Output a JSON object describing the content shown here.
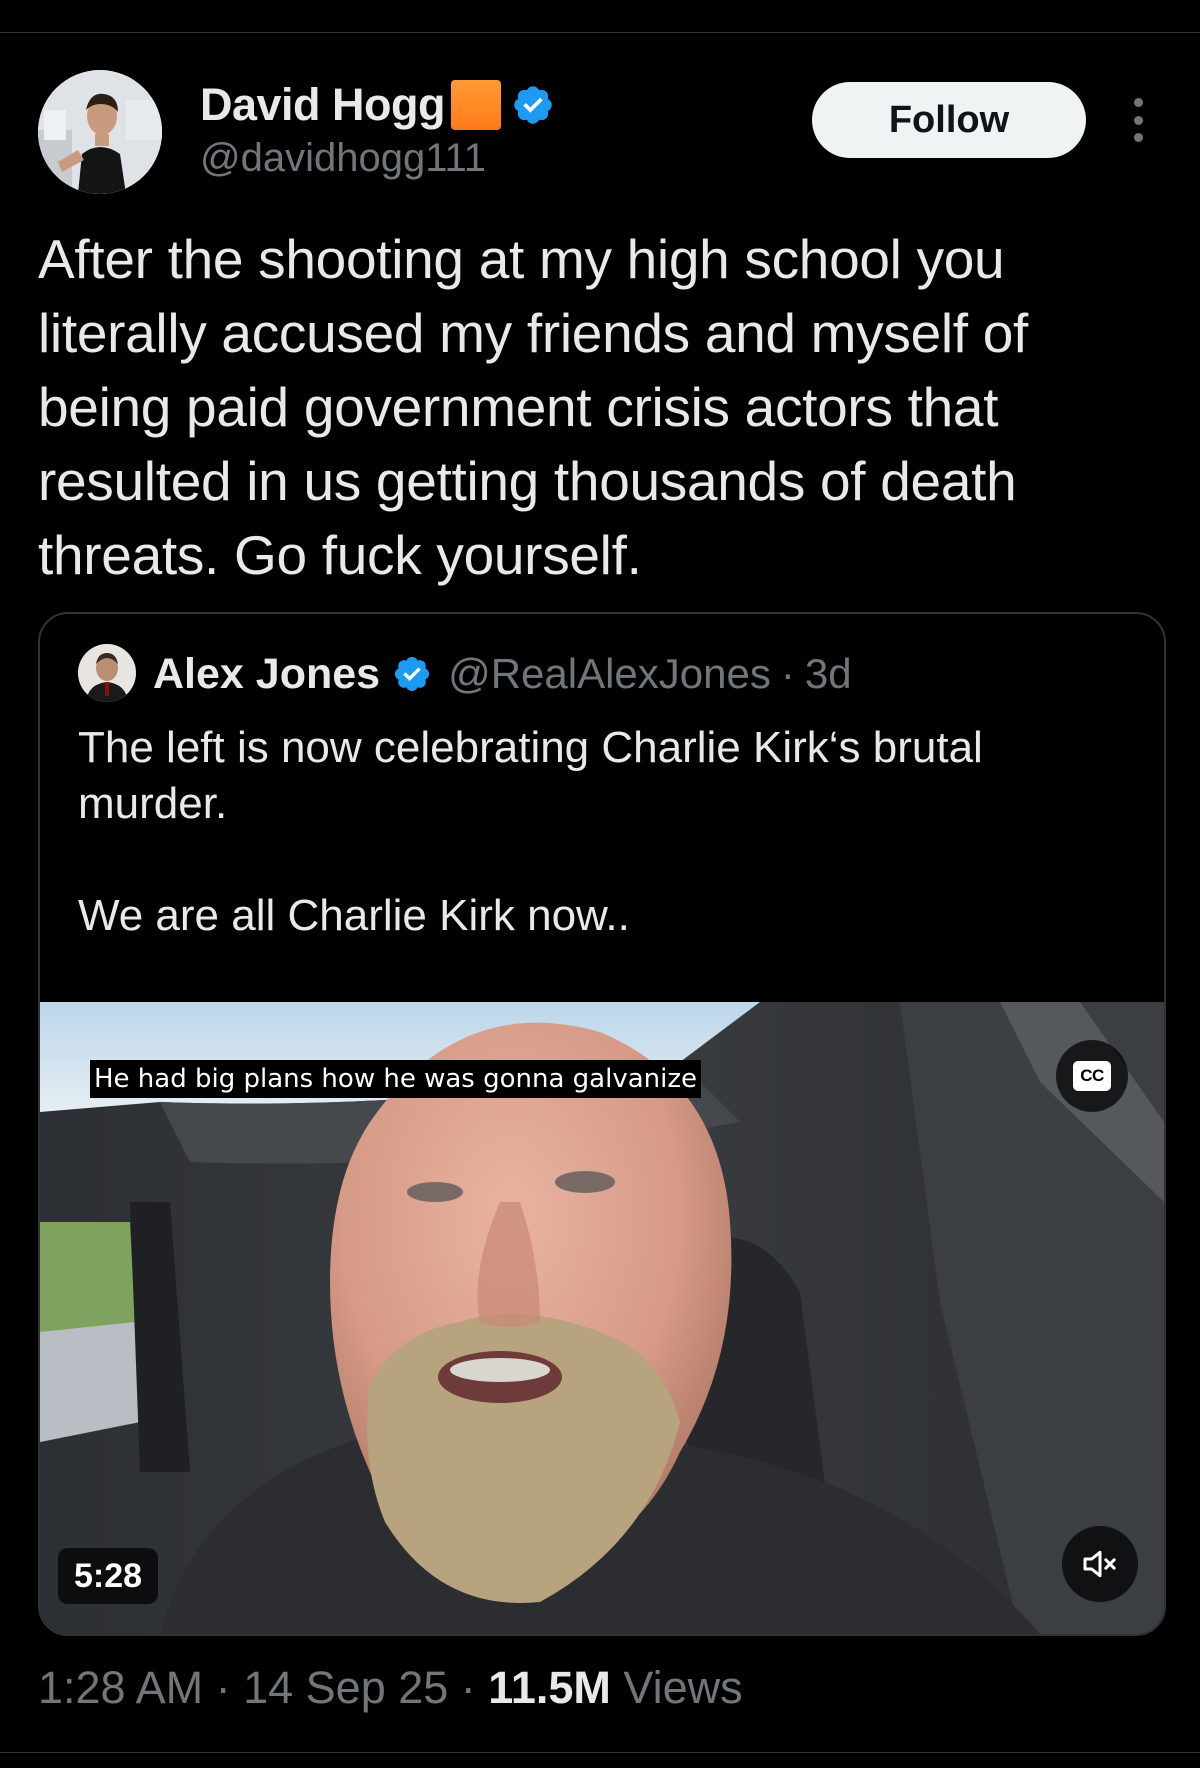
{
  "post": {
    "author": {
      "display_name": "David Hogg",
      "handle": "@davidhogg111",
      "emoji_badge": "orange-square",
      "verified": true,
      "verified_color": "#1d9bf0"
    },
    "follow_label": "Follow",
    "more_icon": "more-vertical-icon",
    "text": "After the shooting at my high school you literally accused my friends and myself of being paid government crisis actors that resulted in us getting thousands of death threats. Go fuck yourself.",
    "quote": {
      "author": {
        "display_name": "Alex Jones",
        "handle": "@RealAlexJones",
        "verified": true
      },
      "separator": "·",
      "time": "3d",
      "text": "The left is now celebrating Charlie Kirk‘s brutal murder.\n\nWe are all Charlie Kirk now..",
      "video": {
        "caption": "He had big plans how he was gonna galvanize",
        "cc_label": "CC",
        "duration": "5:28",
        "mute_icon": "speaker-muted-icon"
      }
    },
    "meta": {
      "time": "1:28 AM",
      "separator": " · ",
      "date": "14 Sep 25",
      "views_count": "11.5M",
      "views_label": " Views"
    }
  },
  "colors": {
    "background": "#000000",
    "text_primary": "#e7e9ea",
    "text_secondary": "#71767b",
    "border": "#2f3336",
    "follow_bg": "#eff3f4",
    "accent_blue": "#1d9bf0",
    "orange_emoji": "#ff8a1f"
  }
}
